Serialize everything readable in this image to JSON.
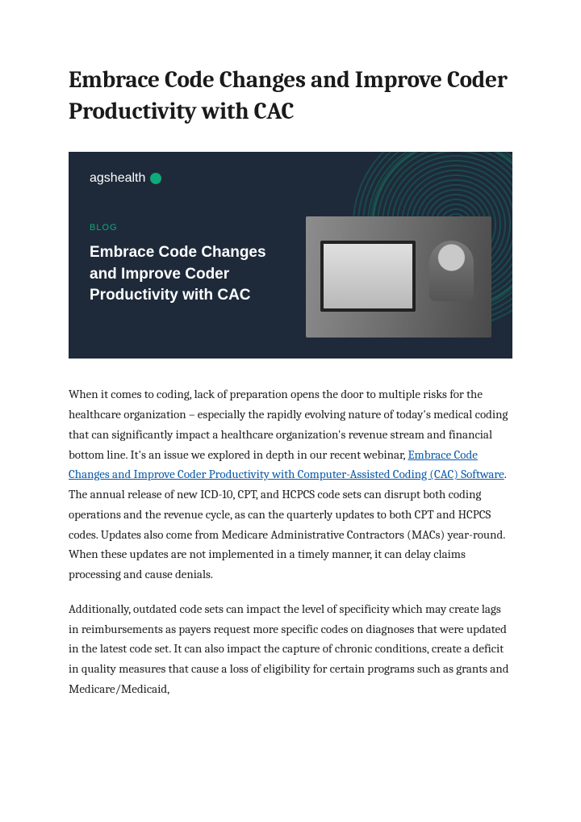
{
  "title": "Embrace Code Changes and Improve Coder Productivity with CAC",
  "hero": {
    "brand": "agshealth",
    "label": "BLOG",
    "heading": "Embrace Code Changes and Improve Coder Productivity with CAC"
  },
  "body": {
    "p1_pre": "When it comes to coding, lack of preparation opens the door to multiple risks for the healthcare organization – especially the rapidly evolving nature of today's medical coding that can significantly impact a healthcare organization's revenue stream and financial bottom line. It's an issue we explored in depth in our recent webinar, ",
    "p1_link": "Embrace Code Changes and Improve Coder Productivity with Computer-Assisted Coding (CAC) Software",
    "p1_post": ".",
    "p2": "The annual release of new ICD-10, CPT, and HCPCS code sets can disrupt both coding operations and the revenue cycle, as can the quarterly updates to both CPT and HCPCS codes. Updates also come from Medicare Administrative Contractors (MACs) year-round. When these updates are not implemented in a timely manner, it can delay claims processing and cause denials.",
    "p3": "Additionally, outdated code sets can impact the level of specificity which may create lags in reimbursements as payers request more specific codes on diagnoses that were updated in the latest code set. It can also impact the capture of chronic conditions, create a deficit in quality measures that cause a loss of eligibility for certain programs such as grants and Medicare/Medicaid,"
  }
}
